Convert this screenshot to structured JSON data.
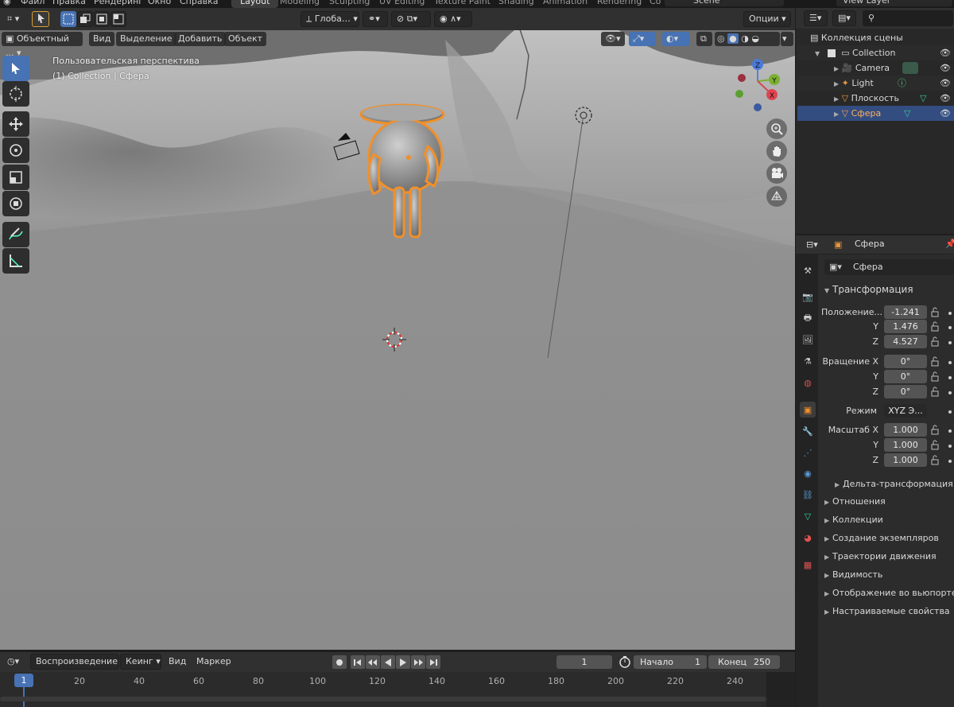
{
  "topbar": {
    "menus": [
      "Файл",
      "Правка",
      "Рендеринг",
      "Окно",
      "Справка"
    ],
    "workspaces": [
      "Layout",
      "Modeling",
      "Sculpting",
      "UV Editing",
      "Texture Paint",
      "Shading",
      "Animation",
      "Rendering",
      "Co"
    ],
    "active_workspace": "Layout",
    "scene": "Scene",
    "view_layer": "View Layer"
  },
  "viewport_header": {
    "orientation": "Глоба…",
    "options_label": "Опции",
    "mode": "Объектный ...",
    "menus": [
      "Вид",
      "Выделение",
      "Добавить",
      "Объект"
    ]
  },
  "viewport": {
    "perspective_label": "Пользовательская перспектива",
    "collection_label": "(1) Collection | Сфера",
    "gizmo_axes": [
      "X",
      "Y",
      "Z"
    ]
  },
  "outliner": {
    "header_search_placeholder": "",
    "root": "Коллекция сцены",
    "items": [
      {
        "name": "Collection",
        "icon": "collection-icon"
      },
      {
        "name": "Camera",
        "icon": "camera-icon"
      },
      {
        "name": "Light",
        "icon": "light-icon"
      },
      {
        "name": "Плоскость",
        "icon": "mesh-icon"
      },
      {
        "name": "Сфера",
        "icon": "mesh-icon",
        "selected": true
      }
    ]
  },
  "properties": {
    "header_object": "Сфера",
    "object_name": "Сфера",
    "transform_title": "Трансформация",
    "location_label": "Положение...",
    "location": [
      "-1.241",
      "1.476",
      "4.527"
    ],
    "rotation_label": "Вращение X",
    "rotation": [
      "0°",
      "0°",
      "0°"
    ],
    "mode_label": "Режим",
    "mode_value": "XYZ Э...",
    "scale_label": "Масштаб X",
    "scale": [
      "1.000",
      "1.000",
      "1.000"
    ],
    "axis_y": "Y",
    "axis_z": "Z",
    "delta": "Дельта-трансформация",
    "sections": [
      "Отношения",
      "Коллекции",
      "Создание экземпляров",
      "Траектории движения",
      "Видимость",
      "Отображение во вьюпорте",
      "Настраиваемые свойства"
    ]
  },
  "timeline": {
    "playback": "Воспроизведение",
    "keying": "Кеинг",
    "view": "Вид",
    "marker": "Маркер",
    "current_frame": "1",
    "start_label": "Начало",
    "start": "1",
    "end_label": "Конец",
    "end": "250",
    "ticks": [
      "1",
      "20",
      "40",
      "60",
      "80",
      "100",
      "120",
      "140",
      "160",
      "180",
      "200",
      "220",
      "240"
    ]
  },
  "colors": {
    "accent": "#4772b3",
    "selection_orange": "#f0902a",
    "outliner_selected": "#334d80"
  }
}
